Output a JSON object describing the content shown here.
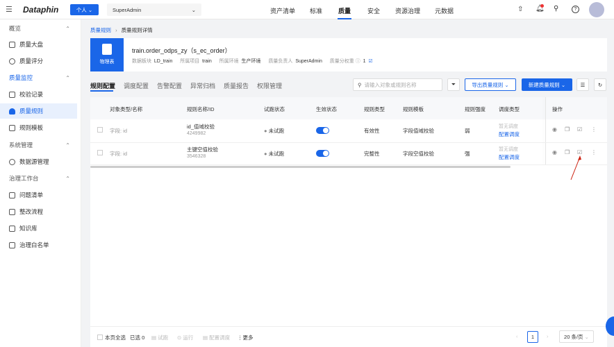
{
  "header": {
    "logo": "Dataphin",
    "mode": "个人",
    "user_select": "SuperAdmin",
    "nav": [
      "资产清单",
      "标准",
      "质量",
      "安全",
      "资源治理",
      "元数据"
    ],
    "active_nav": "质量"
  },
  "sidebar": {
    "items": [
      {
        "label": "概览",
        "type": "group"
      },
      {
        "label": "质量大盘"
      },
      {
        "label": "质量评分"
      },
      {
        "label": "质量监控",
        "type": "group"
      },
      {
        "label": "校验记录"
      },
      {
        "label": "质量规则",
        "active": true
      },
      {
        "label": "规则模板"
      },
      {
        "label": "系统管理",
        "type": "group"
      },
      {
        "label": "数据源管理"
      },
      {
        "label": "治理工作台",
        "type": "group"
      },
      {
        "label": "问题清单"
      },
      {
        "label": "整改流程"
      },
      {
        "label": "知识库"
      },
      {
        "label": "治理白名单"
      }
    ]
  },
  "breadcrumb": {
    "parent": "质量规则",
    "current": "质量规则详情"
  },
  "object": {
    "icon_label": "物理表",
    "title": "train.order_odps_zy（s_ec_order）",
    "meta": [
      {
        "k": "数据板块",
        "v": "LD_train"
      },
      {
        "k": "所属项目",
        "v": "train"
      },
      {
        "k": "所属环境",
        "v": "生产环境"
      },
      {
        "k": "质量负责人",
        "v": "SuperAdmin"
      },
      {
        "k": "质量分权重",
        "v": "1"
      }
    ]
  },
  "tabs": [
    "规则配置",
    "调度配置",
    "告警配置",
    "异常归档",
    "质量报告",
    "权限管理"
  ],
  "toolbar": {
    "search_placeholder": "请输入对象或规则名称",
    "export": "导出质量规则",
    "create": "新建质量规则"
  },
  "table": {
    "columns": [
      "对象类型/名称",
      "规则名称/ID",
      "试跑状态",
      "生效状态",
      "规则类型",
      "规则模板",
      "规则强度",
      "调度类型",
      "操作"
    ],
    "rows": [
      {
        "object": "字段: id",
        "rule": "id_值域校验",
        "id": "4249982",
        "trial": "未试跑",
        "enabled": true,
        "type": "有效性",
        "template": "字段值域校验",
        "strength": "弱",
        "sched": "暂无调度",
        "sched_link": "配置调度"
      },
      {
        "object": "字段: id",
        "rule": "主键空值校验",
        "id": "3546328",
        "trial": "未试跑",
        "enabled": true,
        "type": "完整性",
        "template": "字段空值校验",
        "strength": "强",
        "sched": "暂无调度",
        "sched_link": "配置调度"
      }
    ]
  },
  "footer": {
    "select_all": "本页全选",
    "selected": "已选 0",
    "trial": "试跑",
    "run": "运行",
    "config": "配置调度",
    "more": "更多",
    "page": "1",
    "page_size": "20 条/页"
  },
  "colors": {
    "primary": "#1a66e8"
  }
}
